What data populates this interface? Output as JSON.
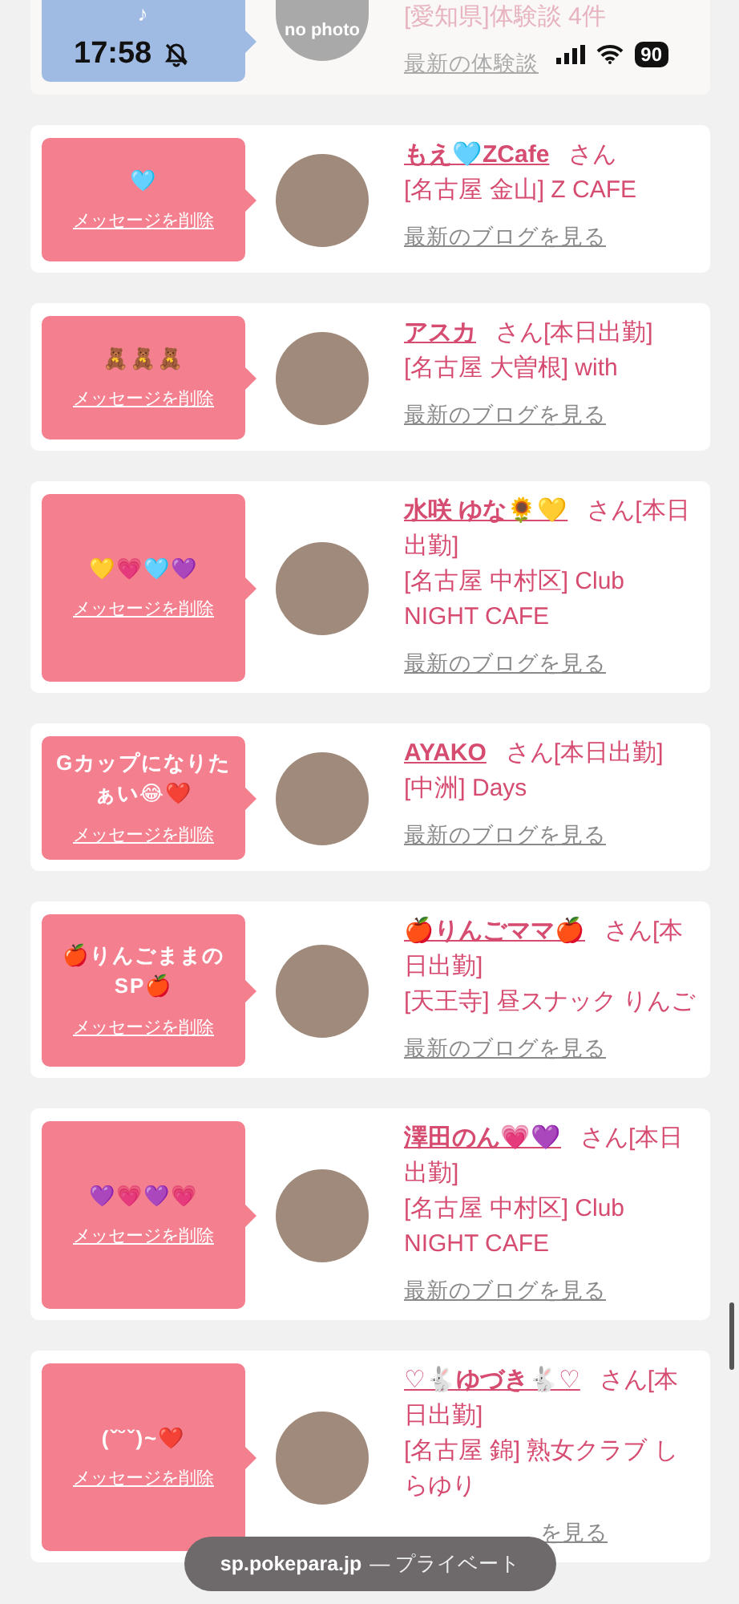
{
  "status_bar": {
    "time": "17:58",
    "battery": "90"
  },
  "top_card": {
    "message": "♪",
    "avatar_text": "no photo",
    "address": "[愛知県]体験談 4件",
    "link": "最新の体験談"
  },
  "cards": [
    {
      "message": "🩵",
      "delete_label": "メッセージを削除",
      "name": "もえ🩵ZCafe",
      "honorific": "さん",
      "address": "[名古屋 金山] Z CAFE",
      "link": "最新のブログを見る"
    },
    {
      "message": "🧸🧸🧸",
      "delete_label": "メッセージを削除",
      "name": "アスカ",
      "honorific": "さん",
      "status": "[本日出勤]",
      "address": "[名古屋 大曽根] with",
      "link": "最新のブログを見る"
    },
    {
      "message": "💛💗🩵💜",
      "delete_label": "メッセージを削除",
      "name": "水咲 ゆな🌻💛",
      "honorific": "さん",
      "status": "[本日出勤]",
      "address": "[名古屋 中村区] Club NIGHT CAFE",
      "link": "最新のブログを見る"
    },
    {
      "message": "Gカップになりたぁい😂❤️",
      "delete_label": "メッセージを削除",
      "name": "AYAKO",
      "honorific": "さん",
      "status": "[本日出勤]",
      "address": "[中洲] Days",
      "link": "最新のブログを見る"
    },
    {
      "message": "🍎りんごままのSP🍎",
      "delete_label": "メッセージを削除",
      "name": "🍎りんごママ🍎",
      "honorific": "さん",
      "status": "[本日出勤]",
      "address": "[天王寺] 昼スナック りんご",
      "link": "最新のブログを見る"
    },
    {
      "message": "💜💗💜💗",
      "delete_label": "メッセージを削除",
      "name": "澤田のん💗💜",
      "honorific": "さん",
      "status": "[本日出勤]",
      "address": "[名古屋 中村区] Club NIGHT CAFE",
      "link": "最新のブログを見る"
    },
    {
      "message": "(ˇ˘ˇ)~❤️",
      "delete_label": "メッセージを削除",
      "name": "♡🐇ゆづき🐇♡",
      "honorific": "さん",
      "status": "[本日出勤]",
      "address": "[名古屋 錦] 熟女クラブ しらゆり",
      "link": "を見る"
    }
  ],
  "url_pill": {
    "domain": "sp.pokepara.jp",
    "mode": "— プライベート"
  }
}
